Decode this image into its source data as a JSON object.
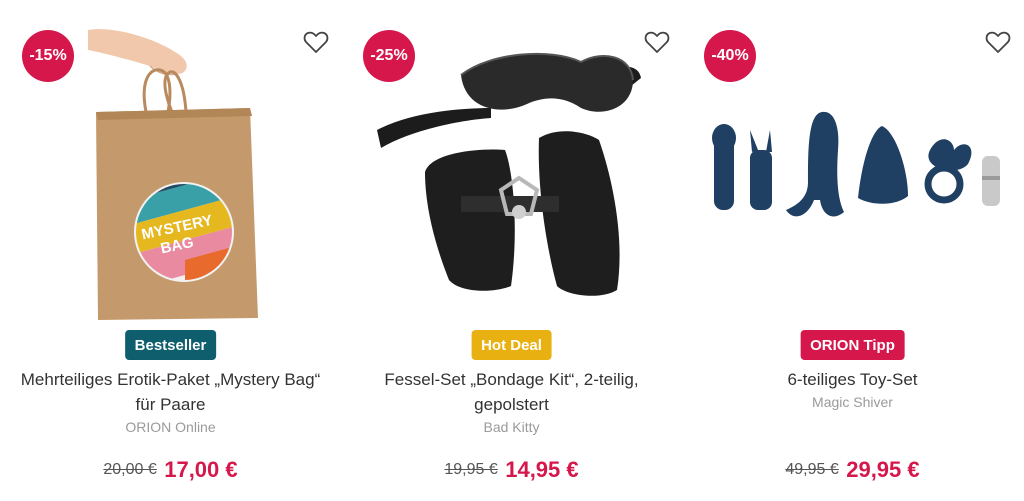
{
  "colors": {
    "accent": "#d5174b",
    "badge_bestseller": "#0f5e6e",
    "badge_hotdeal": "#e8b010",
    "badge_tipp": "#d5174b",
    "price": "#d5174b"
  },
  "products": [
    {
      "discount": "-15%",
      "wishlist_icon": "heart-outline-icon",
      "badge": "Bestseller",
      "title": "Mehrteiliges Erotik-Paket „Mystery Bag“ für Paare",
      "brand": "ORION Online",
      "old_price": "20,00 €",
      "price": "17,00 €",
      "image_sticker": {
        "line1": "MYSTERY",
        "line2": "BAG"
      }
    },
    {
      "discount": "-25%",
      "wishlist_icon": "heart-outline-icon",
      "badge": "Hot Deal",
      "title": "Fessel-Set „Bondage Kit“, 2-teilig, gepolstert",
      "brand": "Bad Kitty",
      "old_price": "19,95 €",
      "price": "14,95 €"
    },
    {
      "discount": "-40%",
      "wishlist_icon": "heart-outline-icon",
      "badge": "ORION Tipp",
      "title": "6-teiliges Toy-Set",
      "brand": "Magic Shiver",
      "old_price": "49,95 €",
      "price": "29,95 €"
    }
  ]
}
